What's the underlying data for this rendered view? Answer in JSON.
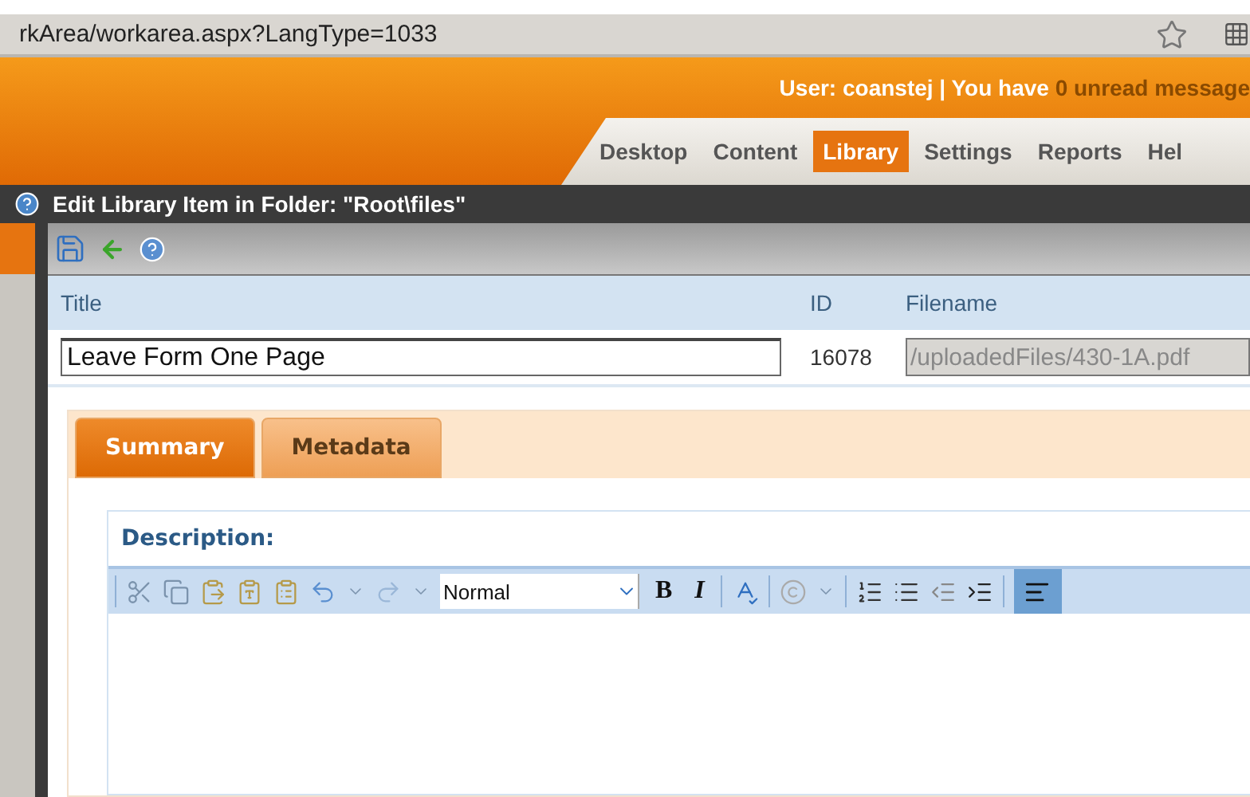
{
  "address_bar": {
    "url": "rkArea/workarea.aspx?LangType=1033"
  },
  "header": {
    "user_prefix": "User: coanstej | You have ",
    "unread": "0 unread message"
  },
  "nav_tabs": [
    {
      "label": "Desktop",
      "selected": false
    },
    {
      "label": "Content",
      "selected": false
    },
    {
      "label": "Library",
      "selected": true
    },
    {
      "label": "Settings",
      "selected": false
    },
    {
      "label": "Reports",
      "selected": false
    },
    {
      "label": "Hel",
      "selected": false
    }
  ],
  "dialog": {
    "title": "Edit Library Item in Folder: \"Root\\files\""
  },
  "fields": {
    "title_label": "Title",
    "id_label": "ID",
    "filename_label": "Filename",
    "title_value": "Leave Form One Page",
    "id_value": "16078",
    "filename_value": "/uploadedFiles/430-1A.pdf"
  },
  "tabs": [
    {
      "label": "Summary",
      "selected": true
    },
    {
      "label": "Metadata",
      "selected": false
    }
  ],
  "description": {
    "label": "Description:"
  },
  "editor_toolbar": {
    "format": "Normal",
    "bold": "B",
    "italic": "I",
    "align_left_selected": true
  }
}
